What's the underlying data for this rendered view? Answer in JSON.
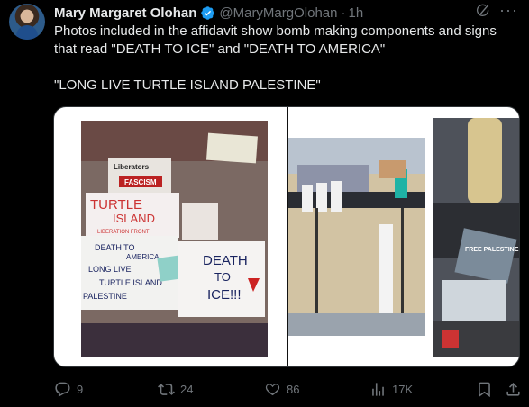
{
  "author": {
    "name": "Mary Margaret Olohan",
    "handle": "@MaryMargOlohan",
    "separator": "·",
    "time": "1h"
  },
  "tweet": {
    "line1": "Photos included in the affidavit show bomb making components and signs",
    "line2": "that read \"DEATH TO ICE\" and \"DEATH TO AMERICA\"",
    "line3": "\"LONG LIVE TURTLE ISLAND PALESTINE\""
  },
  "signs": {
    "liberators": "Liberators",
    "turtle": "TURTLE",
    "island": "ISLAND",
    "front": "LIBERATION FRONT",
    "fascism": "FASCISM",
    "death_america_1": "DEATH TO",
    "death_america_2": "AMERICA",
    "long_live": "LONG LIVE",
    "turtle_island": "TURTLE ISLAND",
    "palestine": "PALESTINE",
    "death_ice_1": "DEATH",
    "death_ice_2": "TO",
    "death_ice_3": "ICE!!!",
    "free_pal": "FREE PALESTINE"
  },
  "actions": {
    "replies": "9",
    "reposts": "24",
    "likes": "86",
    "views": "17K"
  },
  "icons": [
    "verified-badge-icon",
    "grok-icon",
    "more-icon",
    "reply-icon",
    "repost-icon",
    "like-icon",
    "views-icon",
    "bookmark-icon",
    "share-icon"
  ],
  "colors": {
    "background": "#000000",
    "text": "#e7e9ea",
    "muted": "#71767b",
    "verified": "#1d9bf0"
  }
}
